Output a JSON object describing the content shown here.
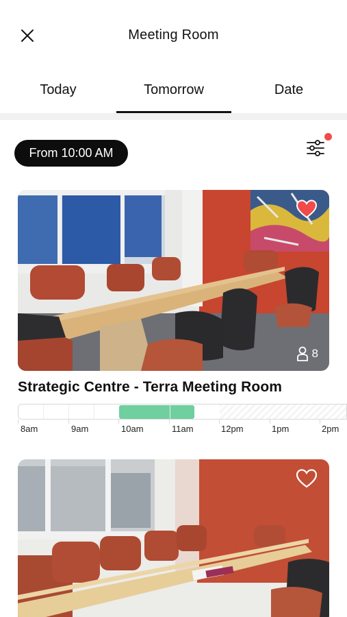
{
  "header": {
    "title": "Meeting Room",
    "close_icon": "close-icon"
  },
  "tabs": [
    {
      "label": "Today",
      "active": false
    },
    {
      "label": "Tomorrow",
      "active": true
    },
    {
      "label": "Date",
      "active": false
    }
  ],
  "filter": {
    "from_label": "From 10:00 AM",
    "filter_icon": "sliders-icon",
    "has_notification": true
  },
  "rooms": [
    {
      "name": "Strategic Centre - Terra Meeting Room",
      "capacity": "8",
      "favorite": true
    },
    {
      "name": "",
      "favorite": false
    }
  ],
  "timeline": {
    "hours": [
      "8am",
      "9am",
      "10am",
      "11am",
      "12pm",
      "1pm",
      "2pm"
    ],
    "booked": {
      "start": "10am",
      "end": "11:30am"
    },
    "unavailable_from": "12pm"
  },
  "colors": {
    "accent_booked": "#6fcf9f",
    "favorite_red": "#f24b4b",
    "notification": "#f24b4b"
  }
}
